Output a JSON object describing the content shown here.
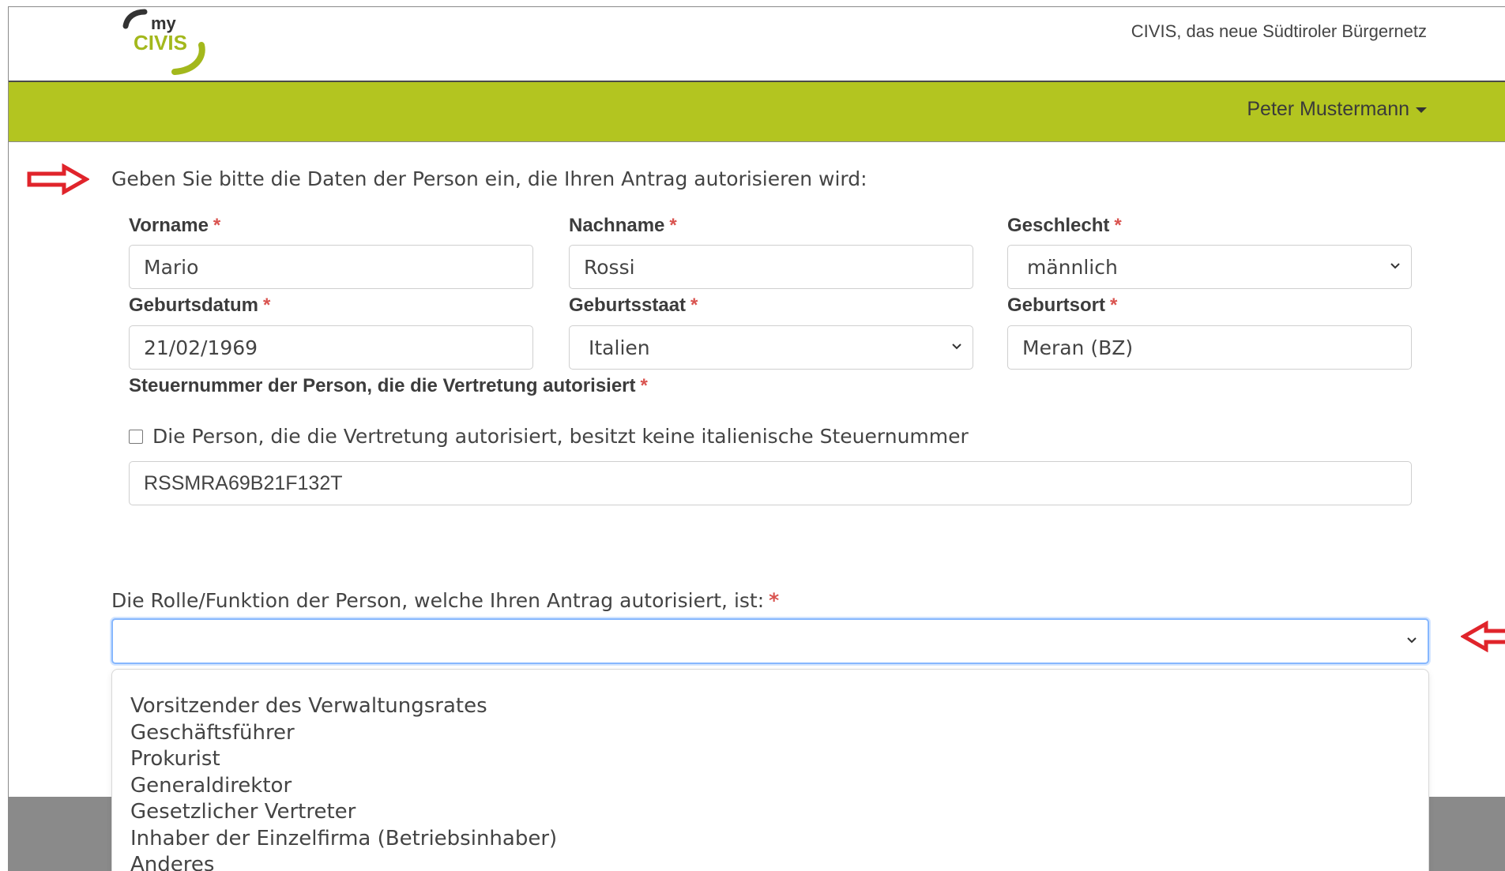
{
  "header": {
    "logo_top": "my",
    "logo_main": "CIVIS",
    "tagline": "CIVIS, das neue Südtiroler Bürgernetz",
    "username": "Peter Mustermann"
  },
  "form": {
    "intro": "Geben Sie bitte die Daten der Person ein, die Ihren Antrag autorisieren wird:",
    "required_mark": "*",
    "vorname": {
      "label": "Vorname",
      "value": "Mario"
    },
    "nachname": {
      "label": "Nachname",
      "value": "Rossi"
    },
    "geschlecht": {
      "label": "Geschlecht",
      "value": "männlich"
    },
    "geburtsdatum": {
      "label": "Geburtsdatum",
      "value": "21/02/1969"
    },
    "geburtsstaat": {
      "label": "Geburtsstaat",
      "value": "Italien"
    },
    "geburtsort": {
      "label": "Geburtsort",
      "value": "Meran (BZ)"
    },
    "steuernummer": {
      "label": "Steuernummer der Person, die die Vertretung autorisiert",
      "checkbox_label": "Die Person, die die Vertretung autorisiert, besitzt keine italienische Steuernummer",
      "checked": false,
      "value": "RSSMRA69B21F132T"
    },
    "rolle": {
      "label": "Die Rolle/Funktion der Person, welche Ihren Antrag autorisiert, ist:",
      "value": "",
      "options": [
        "Vorsitzender des Verwaltungsrates",
        "Geschäftsführer",
        "Prokurist",
        "Generaldirektor",
        "Gesetzlicher Vertreter",
        "Inhaber der Einzelfirma (Betriebsinhaber)",
        "Anderes"
      ]
    }
  },
  "colors": {
    "brand_green": "#b3c520",
    "required_red": "#d9534f",
    "annotation_red": "#e0242b",
    "focus_blue": "#86b7fe"
  }
}
